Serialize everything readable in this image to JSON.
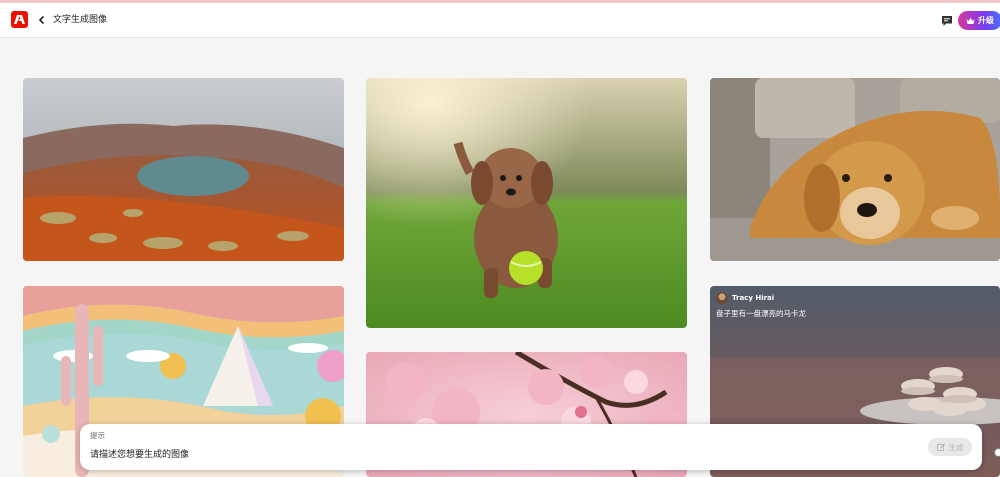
{
  "header": {
    "title": "文字生成图像",
    "upgrade_label": "升级",
    "logo_icon": "adobe-logo-icon",
    "brand_color": "#eb1000"
  },
  "gallery": {
    "cards": [
      {
        "name": "crater-lake-image"
      },
      {
        "name": "puppy-ball-image"
      },
      {
        "name": "golden-retriever-image"
      },
      {
        "name": "paper-landscape-image"
      },
      {
        "name": "cherry-blossom-image"
      },
      {
        "name": "macarons-image"
      }
    ],
    "attribution": {
      "author": "Tracy Hirai",
      "prompt": "盘子里有一盘漂亮的马卡龙"
    }
  },
  "prompt_bar": {
    "label": "提示",
    "value": "请描述您想要生成的图像",
    "generate_label": "生成"
  }
}
